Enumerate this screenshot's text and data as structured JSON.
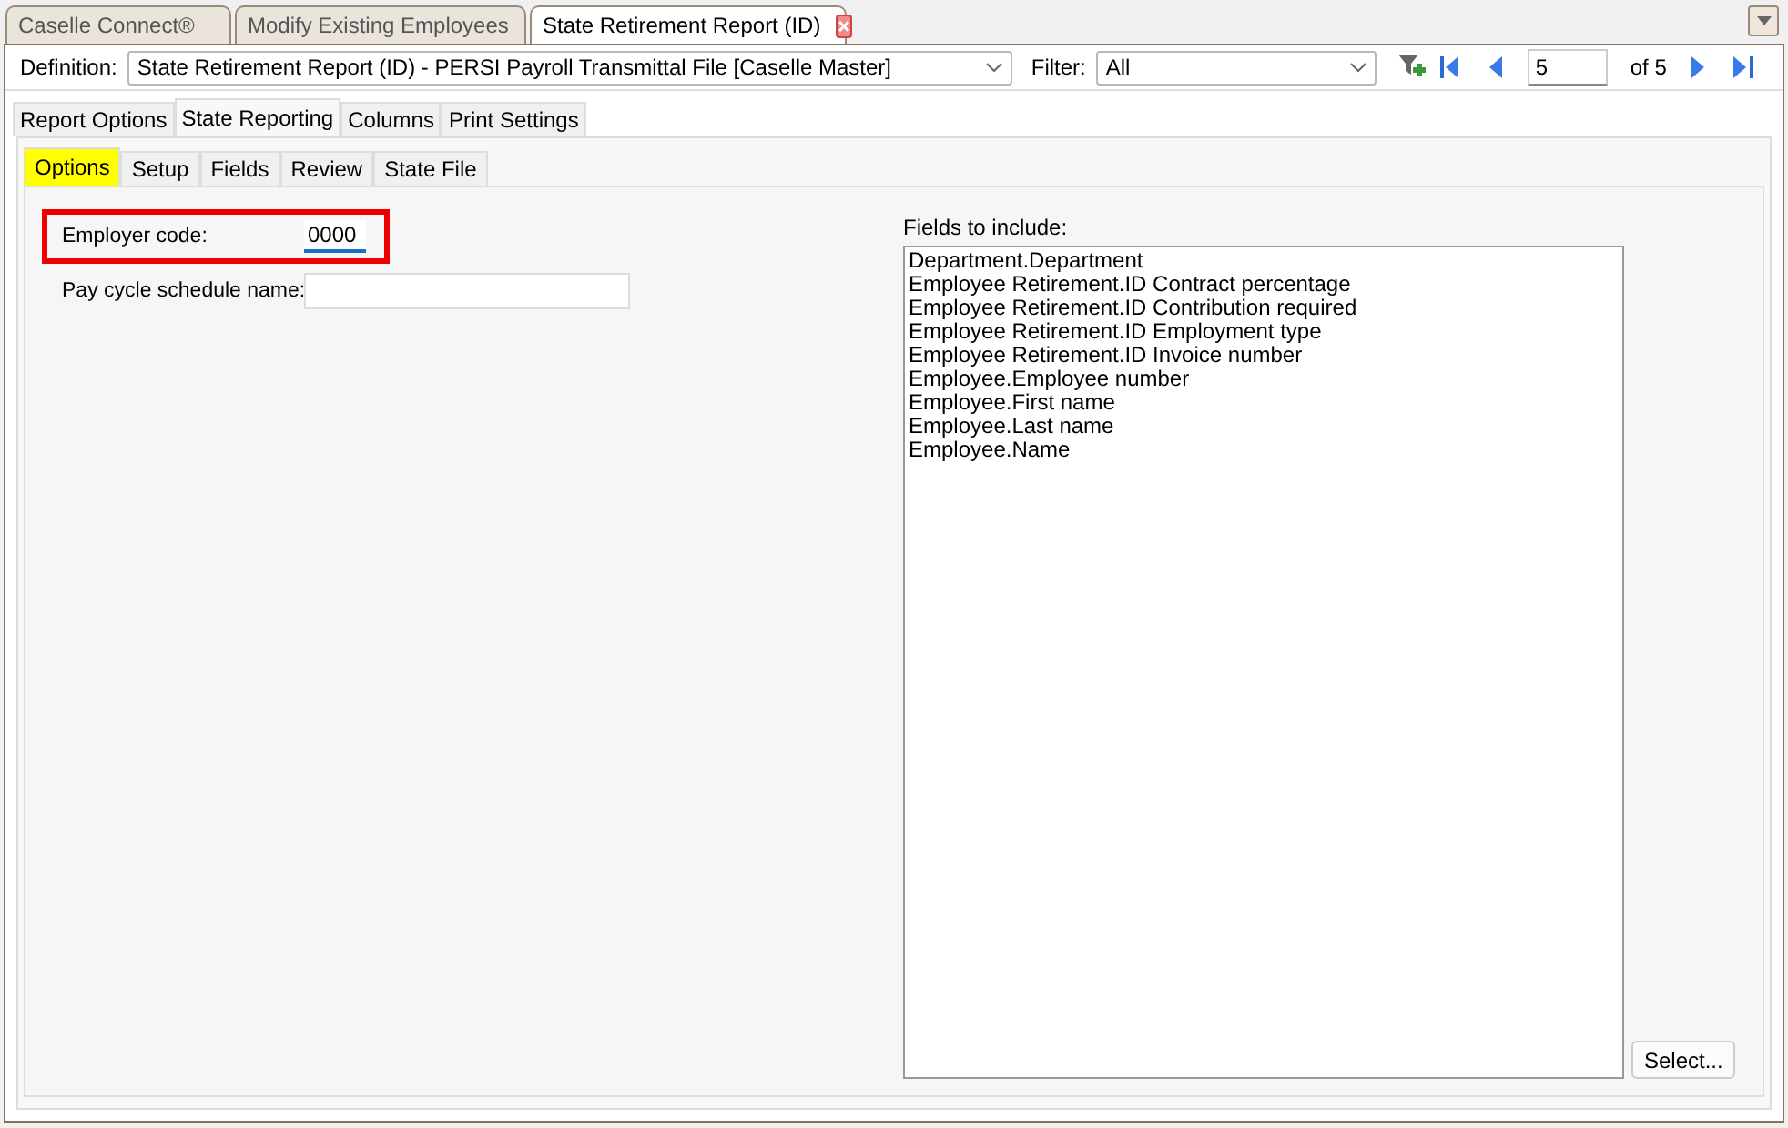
{
  "document_tabs": [
    {
      "label": "Caselle Connect®",
      "selected": false,
      "closable": false
    },
    {
      "label": "Modify Existing Employees",
      "selected": false,
      "closable": false
    },
    {
      "label": "State Retirement Report (ID)",
      "selected": true,
      "closable": true
    }
  ],
  "toolbar": {
    "definition_label": "Definition:",
    "definition_value": "State Retirement Report (ID) - PERSI Payroll Transmittal File [Caselle Master]",
    "filter_label": "Filter:",
    "filter_value": "All",
    "record_value": "5",
    "record_total": "of 5"
  },
  "tabs": [
    {
      "label": "Report Options",
      "selected": false
    },
    {
      "label": "State Reporting",
      "selected": true
    },
    {
      "label": "Columns",
      "selected": false
    },
    {
      "label": "Print Settings",
      "selected": false
    }
  ],
  "subtabs": [
    {
      "label": "Options",
      "selected": true,
      "highlighted": true
    },
    {
      "label": "Setup",
      "selected": false,
      "highlighted": false
    },
    {
      "label": "Fields",
      "selected": false,
      "highlighted": false
    },
    {
      "label": "Review",
      "selected": false,
      "highlighted": false
    },
    {
      "label": "State File",
      "selected": false,
      "highlighted": false
    }
  ],
  "fields": [
    {
      "label": "Employer code:",
      "value": "0000",
      "highlighted": true,
      "kind": "short"
    },
    {
      "label": "Pay cycle schedule name:",
      "highlighted": false,
      "kind": "long"
    }
  ],
  "fields_to_include": {
    "label": "Fields to include:",
    "items": [
      "Department.Department",
      "Employee Retirement.ID Contract percentage",
      "Employee Retirement.ID Contribution required",
      "Employee Retirement.ID Employment type",
      "Employee Retirement.ID Invoice number",
      "Employee.Employee number",
      "Employee.First name",
      "Employee.Last name",
      "Employee.Name"
    ],
    "button": "Select..."
  }
}
